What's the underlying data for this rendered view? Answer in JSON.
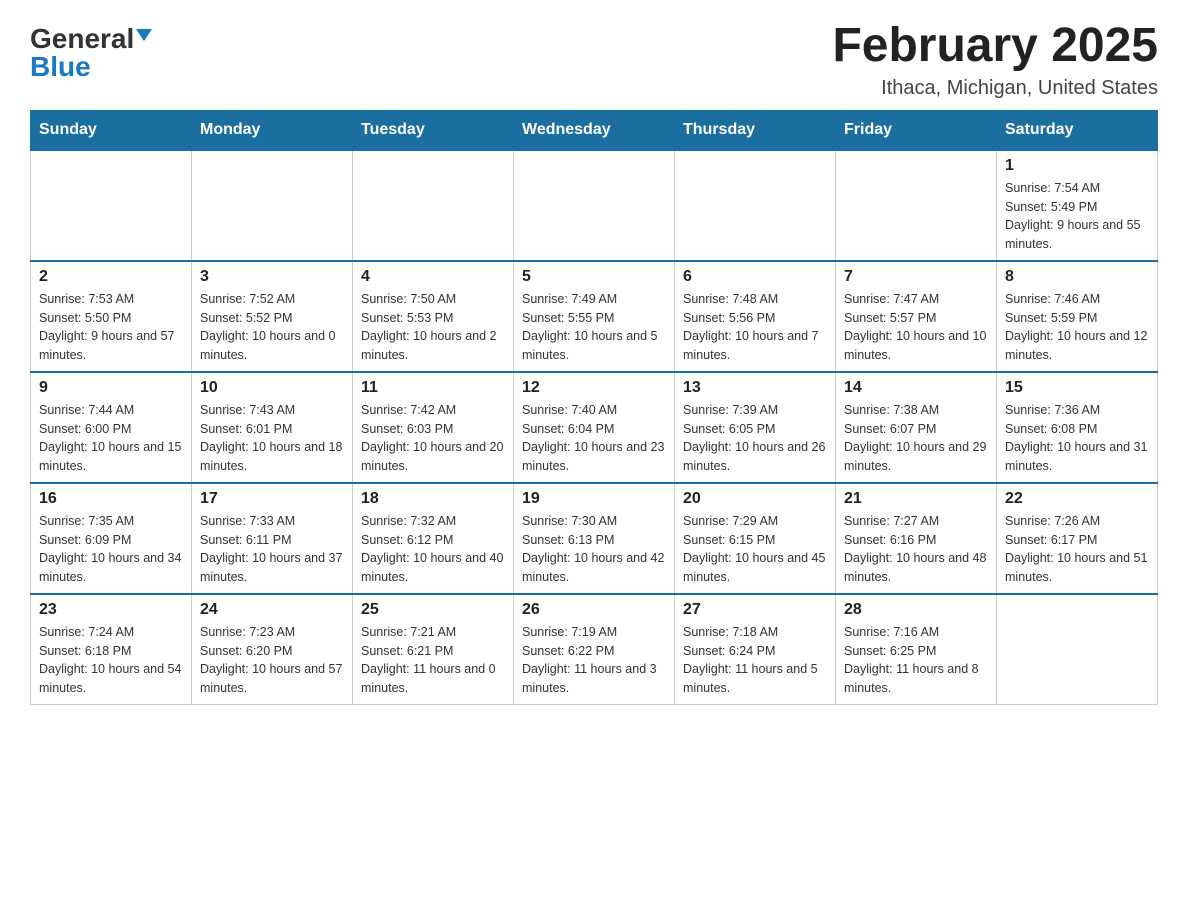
{
  "header": {
    "logo_general": "General",
    "logo_blue": "Blue",
    "month_title": "February 2025",
    "location": "Ithaca, Michigan, United States"
  },
  "days_of_week": [
    "Sunday",
    "Monday",
    "Tuesday",
    "Wednesday",
    "Thursday",
    "Friday",
    "Saturday"
  ],
  "weeks": [
    {
      "days": [
        {
          "date": "",
          "empty": true
        },
        {
          "date": "",
          "empty": true
        },
        {
          "date": "",
          "empty": true
        },
        {
          "date": "",
          "empty": true
        },
        {
          "date": "",
          "empty": true
        },
        {
          "date": "",
          "empty": true
        },
        {
          "date": "1",
          "sunrise": "Sunrise: 7:54 AM",
          "sunset": "Sunset: 5:49 PM",
          "daylight": "Daylight: 9 hours and 55 minutes."
        }
      ]
    },
    {
      "days": [
        {
          "date": "2",
          "sunrise": "Sunrise: 7:53 AM",
          "sunset": "Sunset: 5:50 PM",
          "daylight": "Daylight: 9 hours and 57 minutes."
        },
        {
          "date": "3",
          "sunrise": "Sunrise: 7:52 AM",
          "sunset": "Sunset: 5:52 PM",
          "daylight": "Daylight: 10 hours and 0 minutes."
        },
        {
          "date": "4",
          "sunrise": "Sunrise: 7:50 AM",
          "sunset": "Sunset: 5:53 PM",
          "daylight": "Daylight: 10 hours and 2 minutes."
        },
        {
          "date": "5",
          "sunrise": "Sunrise: 7:49 AM",
          "sunset": "Sunset: 5:55 PM",
          "daylight": "Daylight: 10 hours and 5 minutes."
        },
        {
          "date": "6",
          "sunrise": "Sunrise: 7:48 AM",
          "sunset": "Sunset: 5:56 PM",
          "daylight": "Daylight: 10 hours and 7 minutes."
        },
        {
          "date": "7",
          "sunrise": "Sunrise: 7:47 AM",
          "sunset": "Sunset: 5:57 PM",
          "daylight": "Daylight: 10 hours and 10 minutes."
        },
        {
          "date": "8",
          "sunrise": "Sunrise: 7:46 AM",
          "sunset": "Sunset: 5:59 PM",
          "daylight": "Daylight: 10 hours and 12 minutes."
        }
      ]
    },
    {
      "days": [
        {
          "date": "9",
          "sunrise": "Sunrise: 7:44 AM",
          "sunset": "Sunset: 6:00 PM",
          "daylight": "Daylight: 10 hours and 15 minutes."
        },
        {
          "date": "10",
          "sunrise": "Sunrise: 7:43 AM",
          "sunset": "Sunset: 6:01 PM",
          "daylight": "Daylight: 10 hours and 18 minutes."
        },
        {
          "date": "11",
          "sunrise": "Sunrise: 7:42 AM",
          "sunset": "Sunset: 6:03 PM",
          "daylight": "Daylight: 10 hours and 20 minutes."
        },
        {
          "date": "12",
          "sunrise": "Sunrise: 7:40 AM",
          "sunset": "Sunset: 6:04 PM",
          "daylight": "Daylight: 10 hours and 23 minutes."
        },
        {
          "date": "13",
          "sunrise": "Sunrise: 7:39 AM",
          "sunset": "Sunset: 6:05 PM",
          "daylight": "Daylight: 10 hours and 26 minutes."
        },
        {
          "date": "14",
          "sunrise": "Sunrise: 7:38 AM",
          "sunset": "Sunset: 6:07 PM",
          "daylight": "Daylight: 10 hours and 29 minutes."
        },
        {
          "date": "15",
          "sunrise": "Sunrise: 7:36 AM",
          "sunset": "Sunset: 6:08 PM",
          "daylight": "Daylight: 10 hours and 31 minutes."
        }
      ]
    },
    {
      "days": [
        {
          "date": "16",
          "sunrise": "Sunrise: 7:35 AM",
          "sunset": "Sunset: 6:09 PM",
          "daylight": "Daylight: 10 hours and 34 minutes."
        },
        {
          "date": "17",
          "sunrise": "Sunrise: 7:33 AM",
          "sunset": "Sunset: 6:11 PM",
          "daylight": "Daylight: 10 hours and 37 minutes."
        },
        {
          "date": "18",
          "sunrise": "Sunrise: 7:32 AM",
          "sunset": "Sunset: 6:12 PM",
          "daylight": "Daylight: 10 hours and 40 minutes."
        },
        {
          "date": "19",
          "sunrise": "Sunrise: 7:30 AM",
          "sunset": "Sunset: 6:13 PM",
          "daylight": "Daylight: 10 hours and 42 minutes."
        },
        {
          "date": "20",
          "sunrise": "Sunrise: 7:29 AM",
          "sunset": "Sunset: 6:15 PM",
          "daylight": "Daylight: 10 hours and 45 minutes."
        },
        {
          "date": "21",
          "sunrise": "Sunrise: 7:27 AM",
          "sunset": "Sunset: 6:16 PM",
          "daylight": "Daylight: 10 hours and 48 minutes."
        },
        {
          "date": "22",
          "sunrise": "Sunrise: 7:26 AM",
          "sunset": "Sunset: 6:17 PM",
          "daylight": "Daylight: 10 hours and 51 minutes."
        }
      ]
    },
    {
      "days": [
        {
          "date": "23",
          "sunrise": "Sunrise: 7:24 AM",
          "sunset": "Sunset: 6:18 PM",
          "daylight": "Daylight: 10 hours and 54 minutes."
        },
        {
          "date": "24",
          "sunrise": "Sunrise: 7:23 AM",
          "sunset": "Sunset: 6:20 PM",
          "daylight": "Daylight: 10 hours and 57 minutes."
        },
        {
          "date": "25",
          "sunrise": "Sunrise: 7:21 AM",
          "sunset": "Sunset: 6:21 PM",
          "daylight": "Daylight: 11 hours and 0 minutes."
        },
        {
          "date": "26",
          "sunrise": "Sunrise: 7:19 AM",
          "sunset": "Sunset: 6:22 PM",
          "daylight": "Daylight: 11 hours and 3 minutes."
        },
        {
          "date": "27",
          "sunrise": "Sunrise: 7:18 AM",
          "sunset": "Sunset: 6:24 PM",
          "daylight": "Daylight: 11 hours and 5 minutes."
        },
        {
          "date": "28",
          "sunrise": "Sunrise: 7:16 AM",
          "sunset": "Sunset: 6:25 PM",
          "daylight": "Daylight: 11 hours and 8 minutes."
        },
        {
          "date": "",
          "empty": true
        }
      ]
    }
  ]
}
